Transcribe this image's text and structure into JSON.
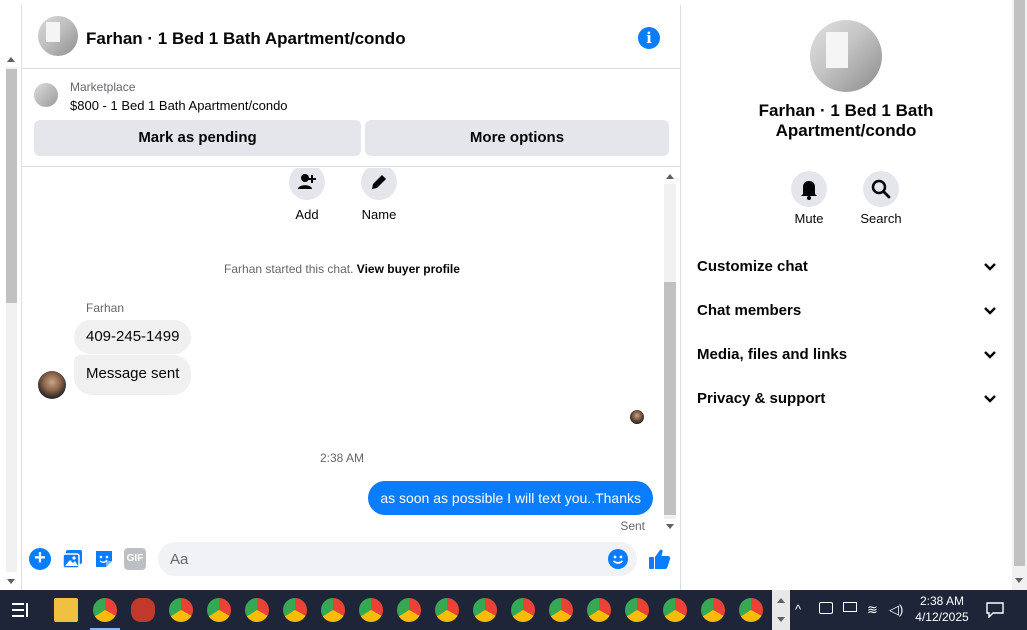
{
  "conversation": {
    "title": "Farhan · 1 Bed 1 Bath Apartment/condo",
    "marketplace_label": "Marketplace",
    "listing": "$800 - 1 Bed 1 Bath Apartment/condo",
    "btn_pending": "Mark as pending",
    "btn_more": "More options",
    "action_add": "Add",
    "action_name": "Name",
    "started_prefix": "Farhan started this chat. ",
    "started_link": "View buyer profile",
    "sender": "Farhan",
    "messages_in": [
      "409-245-1499",
      "Message sent"
    ],
    "timestamp": "2:38 AM",
    "message_out": "as soon as possible I will text you..Thanks",
    "status": "Sent",
    "composer_placeholder": "Aa",
    "gif_label": "GIF"
  },
  "panel": {
    "title": "Farhan · 1 Bed 1 Bath Apartment/condo",
    "mute_label": "Mute",
    "search_label": "Search",
    "sections": [
      "Customize chat",
      "Chat members",
      "Media, files and links",
      "Privacy & support"
    ]
  },
  "taskbar": {
    "time": "2:38 AM",
    "date": "4/12/2025"
  },
  "colors": {
    "accent": "#0a7cff",
    "taskbar": "#1f2538"
  }
}
